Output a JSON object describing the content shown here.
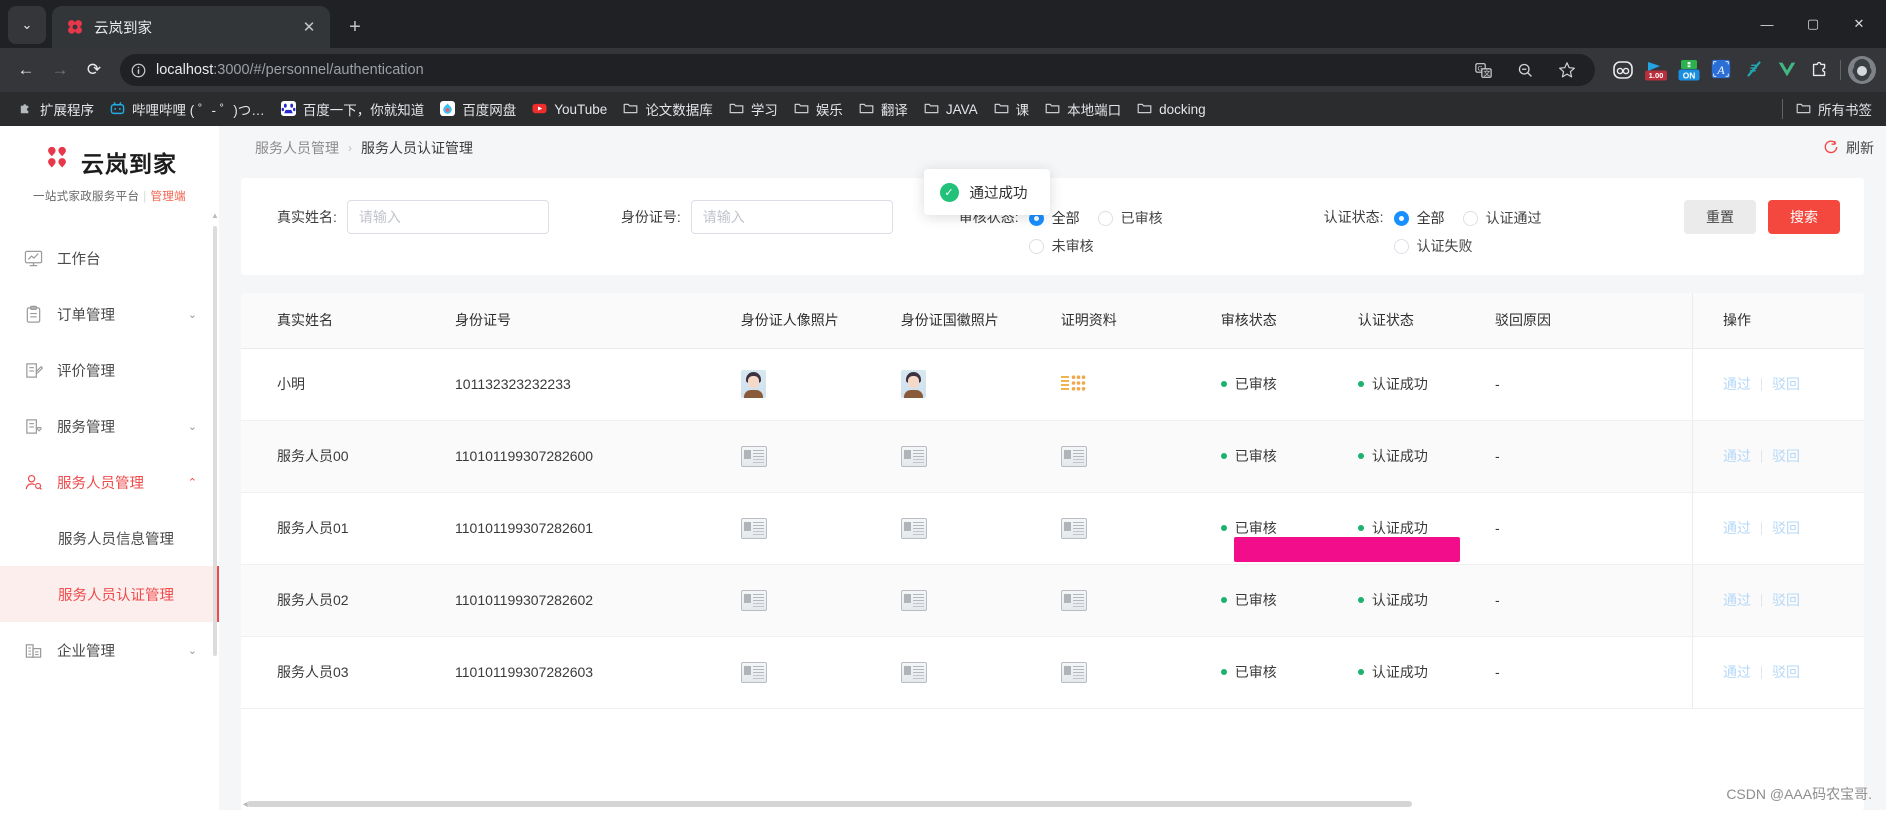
{
  "browser": {
    "tab": {
      "title": "云岚到家",
      "favicon": "yunlan-logo-icon",
      "close_label": "✕"
    },
    "new_tab_label": "+",
    "tab_list_label": "⌄",
    "window": {
      "minimize": "—",
      "maximize": "▢",
      "close": "✕"
    },
    "nav": {
      "back": "←",
      "forward": "→",
      "reload": "⟳"
    },
    "omnibox": {
      "info_icon": "site-info-icon",
      "url_host": "localhost",
      "url_path": ":3000/#/personnel/authentication",
      "url_full": "localhost:3000/#/personnel/authentication"
    },
    "toolbar_icons": [
      "translate-icon",
      "zoom-out-icon",
      "bookmark-star-icon",
      "ext-owl-icon",
      "ext-speed-1.00-icon",
      "ext-on-toggle-icon",
      "ext-blue-a-icon",
      "ext-teal-script-icon",
      "ext-vue-icon",
      "ext-puzzle-icon"
    ],
    "speed_badge": "1.00",
    "on_badge": "ON",
    "a_badge": "A",
    "avatar": "profile-avatar",
    "bookmarks": [
      {
        "label": "扩展程序",
        "icon": "puzzle-icon"
      },
      {
        "label": "哔哩哔哩 ( ゜- ゜)つ…",
        "icon": "bilibili-icon"
      },
      {
        "label": "百度一下，你就知道",
        "icon": "baidu-icon"
      },
      {
        "label": "百度网盘",
        "icon": "baidu-pan-icon"
      },
      {
        "label": "YouTube",
        "icon": "youtube-icon"
      },
      {
        "label": "论文数据库",
        "icon": "folder-icon"
      },
      {
        "label": "学习",
        "icon": "folder-icon"
      },
      {
        "label": "娱乐",
        "icon": "folder-icon"
      },
      {
        "label": "翻译",
        "icon": "folder-icon"
      },
      {
        "label": "JAVA",
        "icon": "folder-icon"
      },
      {
        "label": "课",
        "icon": "folder-icon"
      },
      {
        "label": "本地端口",
        "icon": "folder-icon"
      },
      {
        "label": "docking",
        "icon": "folder-icon"
      }
    ],
    "bookmarks_overflow": {
      "label": "所有书签",
      "icon": "folder-icon"
    }
  },
  "sidebar": {
    "brand": {
      "name": "云岚到家",
      "logo": "clover-heart-logo-icon"
    },
    "tagline": {
      "main": "一站式家政服务平台",
      "divider": "|",
      "admin": "管理端"
    },
    "items": [
      {
        "label": "工作台",
        "icon": "dashboard-icon",
        "expandable": false,
        "active": false
      },
      {
        "label": "订单管理",
        "icon": "clipboard-icon",
        "expandable": true,
        "chevron": "⌄",
        "active": false
      },
      {
        "label": "评价管理",
        "icon": "review-icon",
        "expandable": false,
        "active": false
      },
      {
        "label": "服务管理",
        "icon": "service-icon",
        "expandable": true,
        "chevron": "⌄",
        "active": false
      },
      {
        "label": "服务人员管理",
        "icon": "user-gear-icon",
        "expandable": true,
        "chevron": "⌃",
        "active": true
      },
      {
        "label": "企业管理",
        "icon": "building-icon",
        "expandable": true,
        "chevron": "⌄",
        "active": false
      }
    ],
    "subitems": [
      {
        "label": "服务人员信息管理",
        "current": false
      },
      {
        "label": "服务人员认证管理",
        "current": true
      }
    ]
  },
  "breadcrumb": {
    "parent": "服务人员管理",
    "separator": "›",
    "current": "服务人员认证管理"
  },
  "refresh": {
    "label": "刷新",
    "icon": "refresh-icon"
  },
  "toast": {
    "text": "通过成功",
    "icon": "check-circle-icon",
    "status_color": "#21c17a"
  },
  "filters": {
    "real_name": {
      "label": "真实姓名:",
      "value": "",
      "placeholder": "请输入"
    },
    "id_number": {
      "label": "身份证号:",
      "value": "",
      "placeholder": "请输入"
    },
    "audit_status": {
      "label": "审核状态:",
      "options": [
        {
          "label": "全部",
          "selected": true
        },
        {
          "label": "已审核",
          "selected": false
        },
        {
          "label": "未审核",
          "selected": false
        }
      ]
    },
    "cert_status": {
      "label": "认证状态:",
      "options": [
        {
          "label": "全部",
          "selected": true
        },
        {
          "label": "认证通过",
          "selected": false
        },
        {
          "label": "认证失败",
          "selected": false
        }
      ]
    },
    "reset_button": "重置",
    "search_button": "搜索"
  },
  "table": {
    "columns": [
      "真实姓名",
      "身份证号",
      "身份证人像照片",
      "身份证国徽照片",
      "证明资料",
      "审核状态",
      "认证状态",
      "驳回原因",
      "操作"
    ],
    "rows": [
      {
        "name": "小明",
        "id": "101132323232233",
        "portrait": "person-photo",
        "emblem": "person-photo",
        "proof": "doc-thumb",
        "audit": "已审核",
        "cert": "认证成功",
        "reason": "-",
        "ops": [
          "通过",
          "驳回"
        ]
      },
      {
        "name": "服务人员00",
        "id": "110101199307282600",
        "portrait": "id-card-thumb",
        "emblem": "id-card-thumb",
        "proof": "id-card-thumb",
        "audit": "已审核",
        "cert": "认证成功",
        "reason": "-",
        "ops": [
          "通过",
          "驳回"
        ]
      },
      {
        "name": "服务人员01",
        "id": "110101199307282601",
        "portrait": "id-card-thumb",
        "emblem": "id-card-thumb",
        "proof": "id-card-thumb",
        "audit": "已审核",
        "cert": "认证成功",
        "reason": "-",
        "ops": [
          "通过",
          "驳回"
        ]
      },
      {
        "name": "服务人员02",
        "id": "110101199307282602",
        "portrait": "id-card-thumb",
        "emblem": "id-card-thumb",
        "proof": "id-card-thumb",
        "audit": "已审核",
        "cert": "认证成功",
        "reason": "-",
        "ops": [
          "通过",
          "驳回"
        ]
      },
      {
        "name": "服务人员03",
        "id": "110101199307282603",
        "portrait": "id-card-thumb",
        "emblem": "id-card-thumb",
        "proof": "id-card-thumb",
        "audit": "已审核",
        "cert": "认证成功",
        "reason": "-",
        "ops": [
          "通过",
          "驳回"
        ]
      }
    ],
    "op_divider": "|"
  },
  "annotation": {
    "highlight_color": "#f20d8a"
  },
  "watermark": "CSDN @AAA码农宝哥."
}
